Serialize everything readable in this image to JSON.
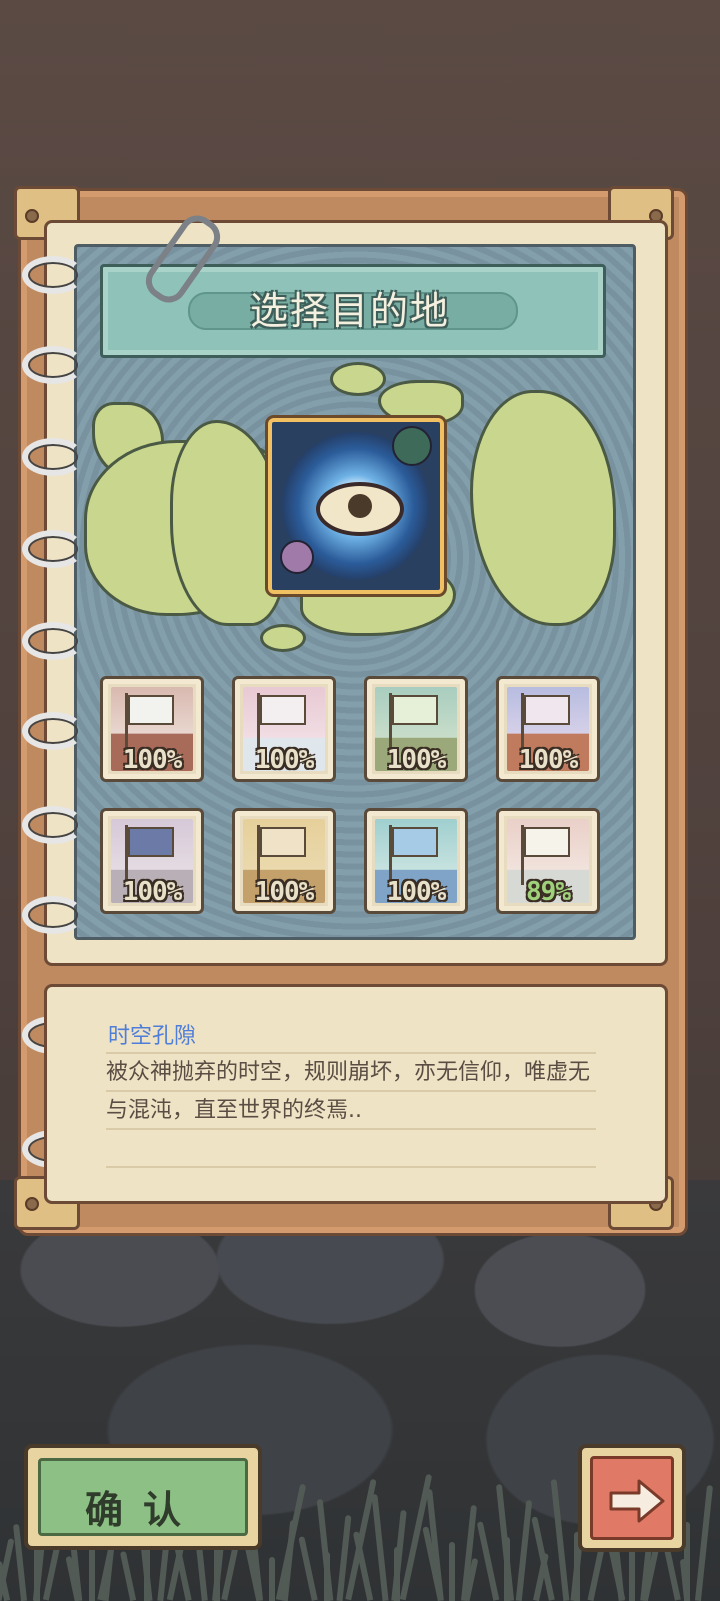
{
  "map_panel": {
    "title": "选择目的地"
  },
  "regions": [
    {
      "id": "r1",
      "progress": "100%"
    },
    {
      "id": "r2",
      "progress": "100%"
    },
    {
      "id": "r3",
      "progress": "100%"
    },
    {
      "id": "r4",
      "progress": "100%"
    },
    {
      "id": "r5",
      "progress": "100%"
    },
    {
      "id": "r6",
      "progress": "100%"
    },
    {
      "id": "r7",
      "progress": "100%"
    },
    {
      "id": "r8",
      "progress": "89%"
    }
  ],
  "description": {
    "name": "时空孔隙",
    "text": "被众神抛弃的时空，规则崩坏，亦无信仰，唯虚无与混沌，直至世界的终焉.."
  },
  "buttons": {
    "confirm_label": "确认",
    "next_icon": "arrow-right-icon"
  },
  "colors": {
    "desc_title": "#4f7ed8",
    "confirm_bg": "#8cc084",
    "next_bg": "#e07a66",
    "portal_border": "#f1c063",
    "partial_progress": "#9ed17a"
  }
}
